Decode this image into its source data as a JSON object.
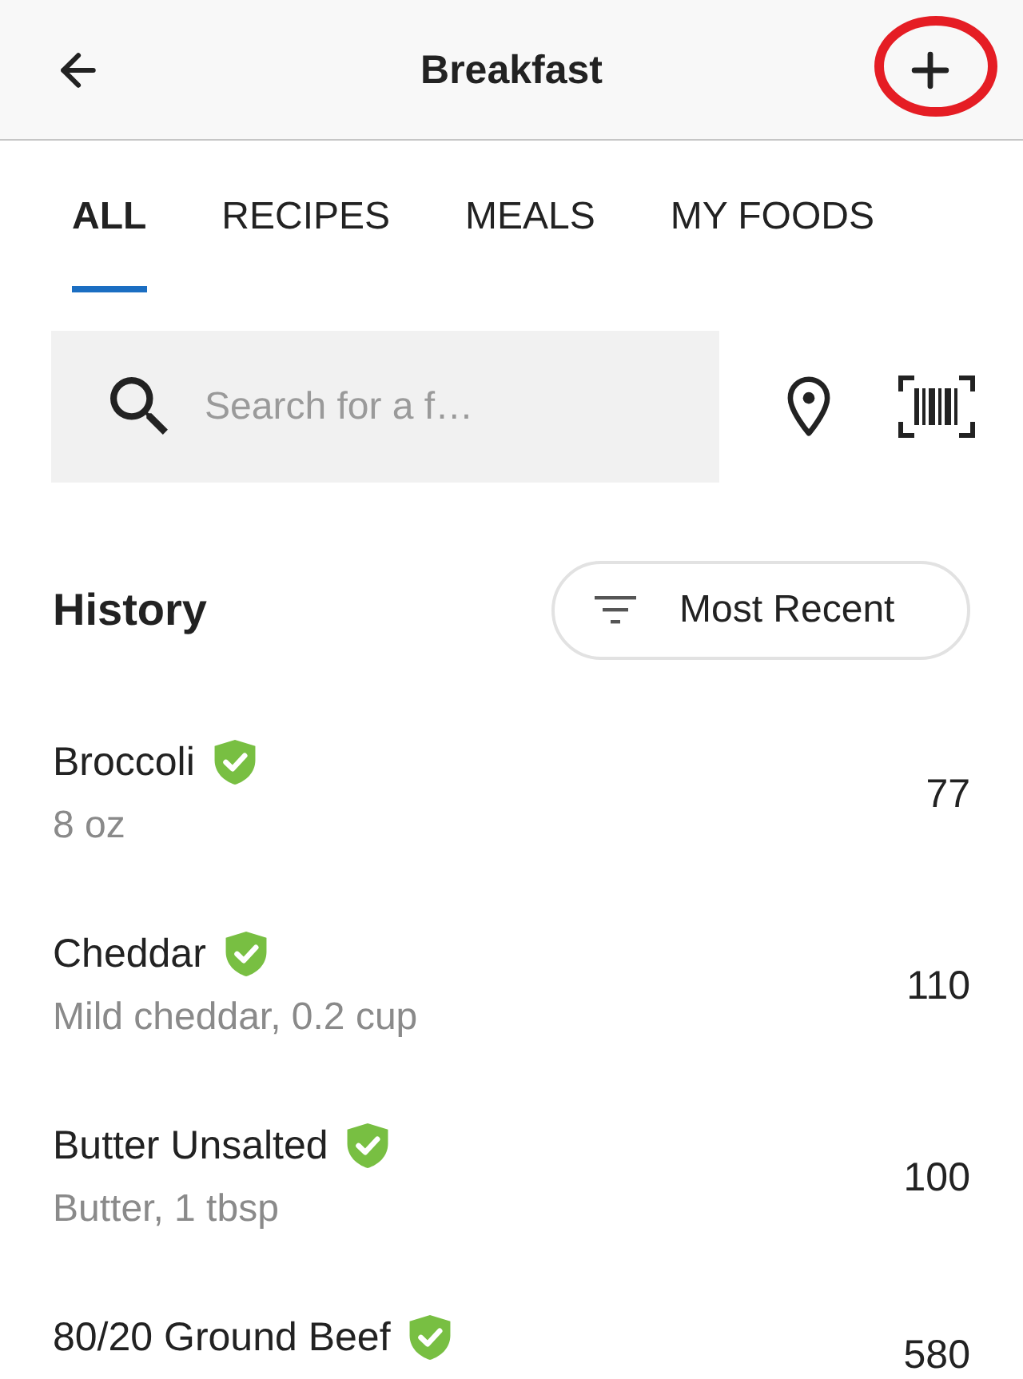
{
  "header": {
    "title": "Breakfast",
    "add_button": {
      "highlighted": true
    }
  },
  "tabs": [
    {
      "label": "ALL",
      "selected": true
    },
    {
      "label": "RECIPES",
      "selected": false
    },
    {
      "label": "MEALS",
      "selected": false
    },
    {
      "label": "MY FOODS",
      "selected": false
    }
  ],
  "search": {
    "placeholder": "Search for a f…"
  },
  "history": {
    "title": "History",
    "sort": "Most Recent"
  },
  "foods": [
    {
      "name": "Broccoli",
      "verified": true,
      "detail": "8 oz",
      "calories": "77"
    },
    {
      "name": "Cheddar",
      "verified": true,
      "detail": "Mild cheddar, 0.2 cup",
      "calories": "110"
    },
    {
      "name": "Butter Unsalted",
      "verified": true,
      "detail": "Butter, 1 tbsp",
      "calories": "100"
    },
    {
      "name": "80/20 Ground Beef",
      "verified": true,
      "calories": "580"
    }
  ]
}
